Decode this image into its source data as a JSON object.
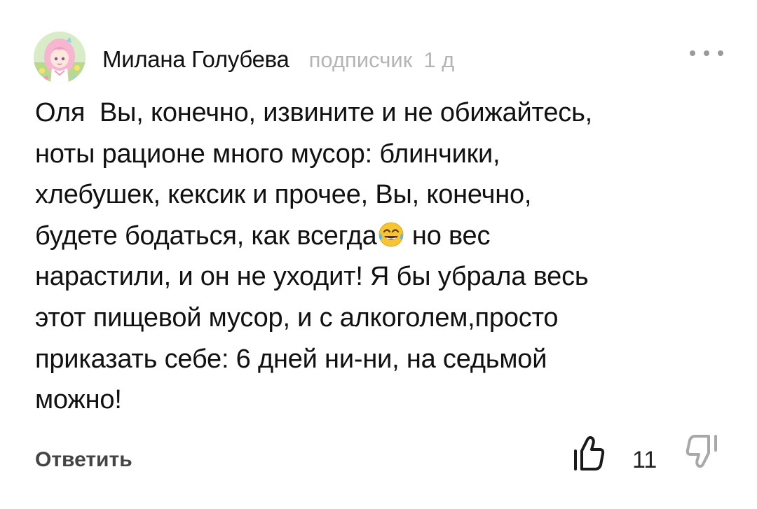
{
  "comment": {
    "author": {
      "name": "Милана Голубева",
      "role": "подписчик",
      "time": "1 д",
      "avatar_icon": "anime-girl-avatar"
    },
    "more_icon": "more-horizontal-icon",
    "text": {
      "before_emoji": "Оля  Вы, конечно, извините и не обижайтесь,\nноты рационе много мусор: блинчики,\nхлебушек, кексик и прочее, Вы, конечно,\nбудете бодаться, как всегда",
      "emoji": "face-with-tears-of-joy",
      "after_emoji": " но вес\nнарастили, и он не уходит! Я бы убрала весь\nэтот пищевой мусор, и с алкоголем,просто\nприказать себе: 6 дней ни-ни, на седьмой\nможно!"
    },
    "actions": {
      "reply_label": "Ответить",
      "like_icon": "thumbs-up-icon",
      "like_count": "11",
      "dislike_icon": "thumbs-down-icon"
    }
  }
}
